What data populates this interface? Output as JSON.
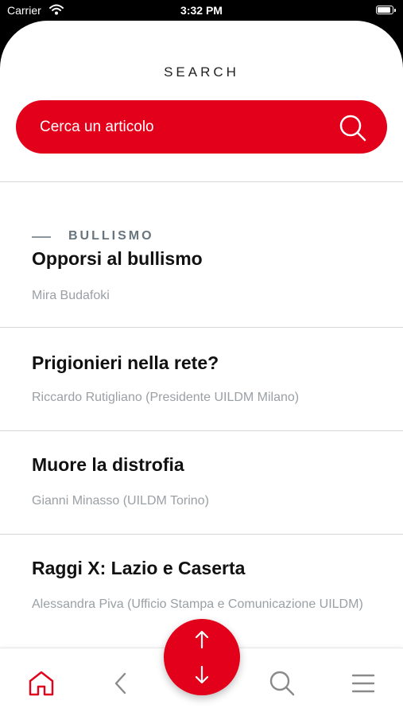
{
  "status_bar": {
    "carrier": "Carrier",
    "time": "3:32 PM"
  },
  "page": {
    "title": "SEARCH"
  },
  "search": {
    "placeholder": "Cerca un articolo",
    "icon": "search-icon"
  },
  "articles": [
    {
      "category": "BULLISMO",
      "title": "Opporsi al bullismo",
      "author": "Mira Budafoki"
    },
    {
      "title": "Prigionieri nella rete?",
      "author": "Riccardo Rutigliano (Presidente UILDM Milano)"
    },
    {
      "title": "Muore la distrofia",
      "author": "Gianni Minasso (UILDM Torino)"
    },
    {
      "title": "Raggi X: Lazio e Caserta",
      "author": "Alessandra Piva (Ufficio Stampa e Comunicazione UILDM)"
    }
  ],
  "tabbar": {
    "items": [
      "home-icon",
      "chevron-left-icon",
      "search-icon",
      "menu-icon"
    ],
    "active": "home-icon"
  },
  "fab": {
    "icons": [
      "arrow-up-icon",
      "arrow-down-icon"
    ]
  },
  "colors": {
    "accent": "#e2001a",
    "category": "#68757e",
    "author": "#9aa0a4"
  }
}
